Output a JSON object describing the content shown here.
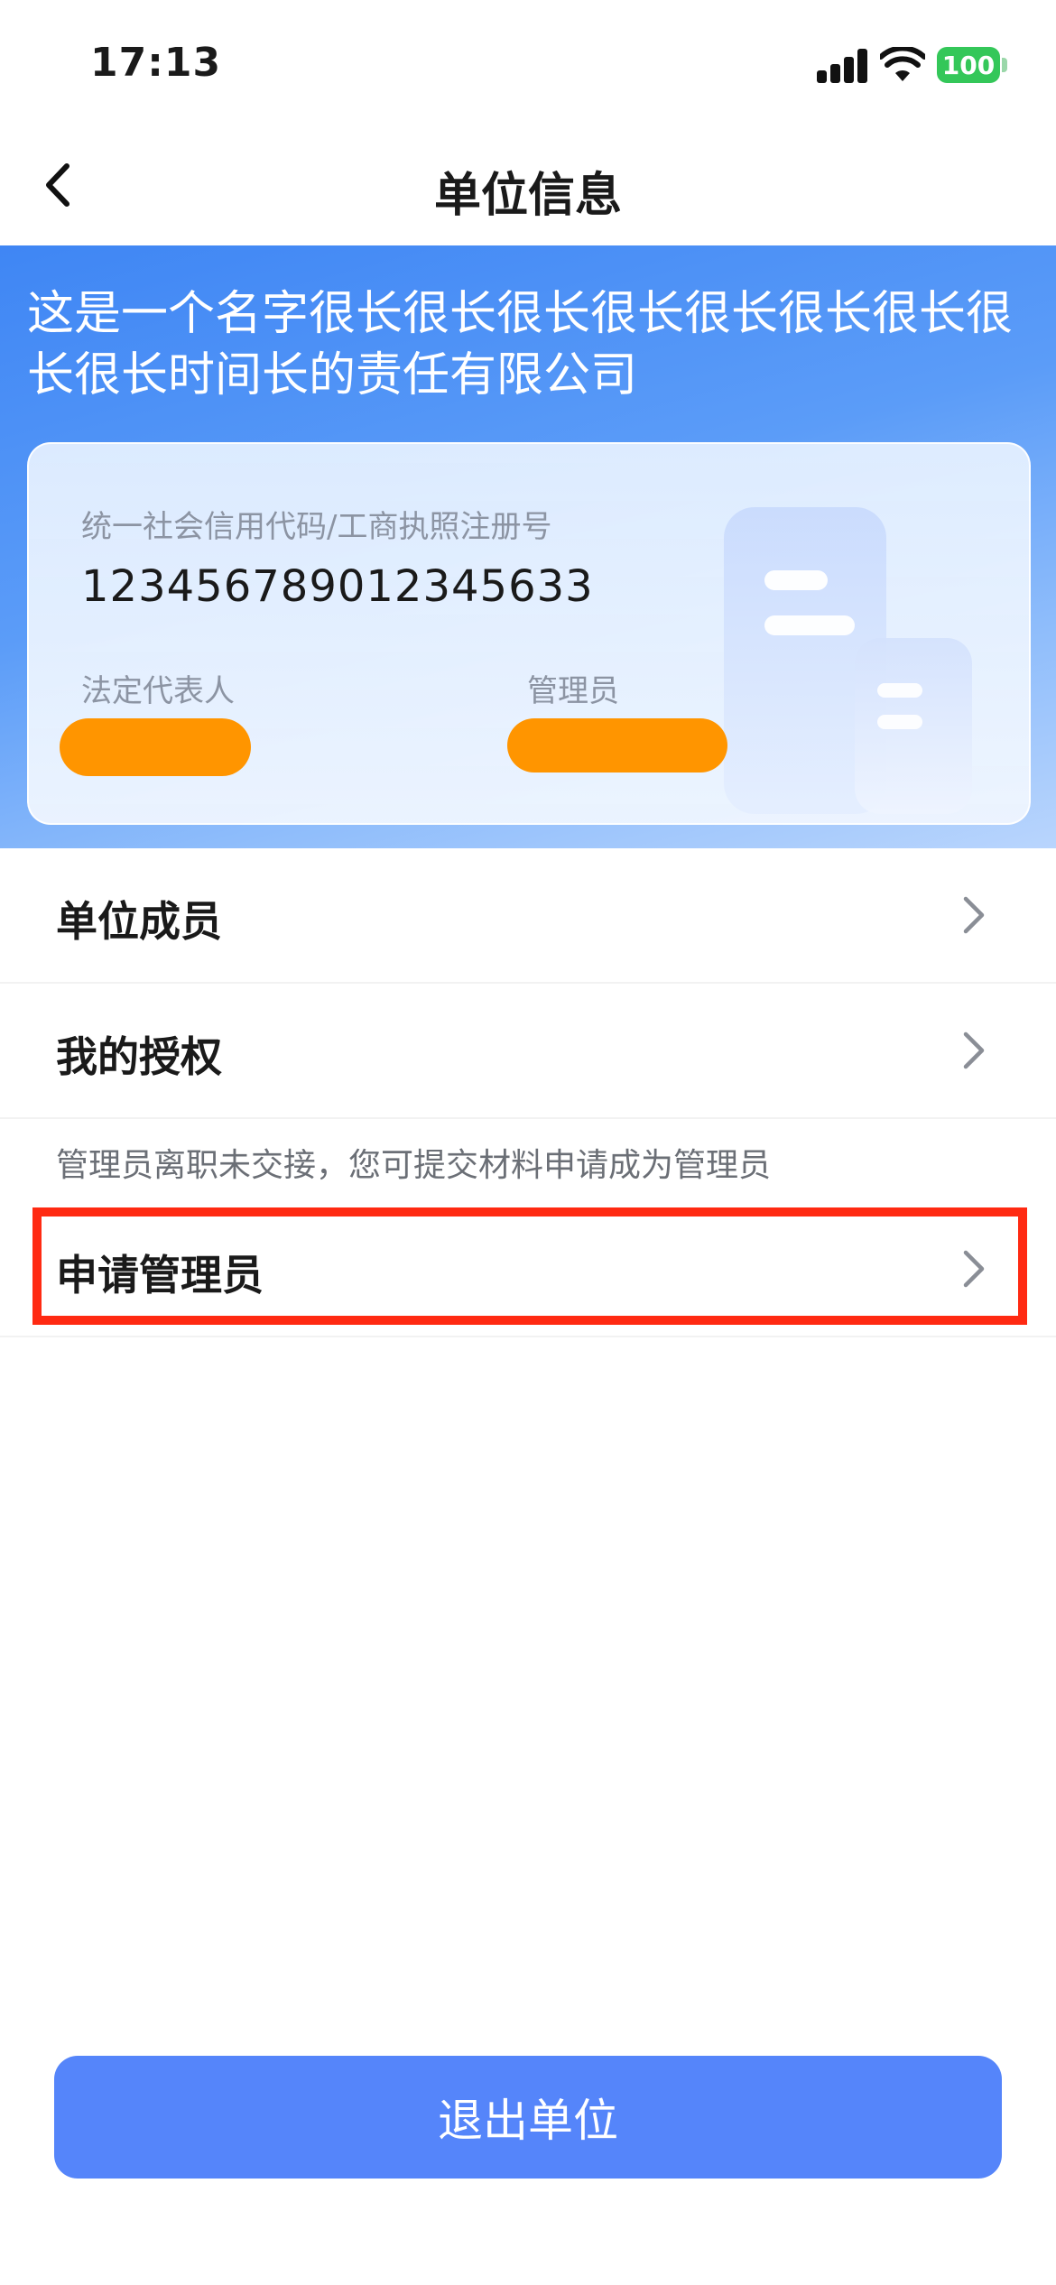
{
  "status_bar": {
    "time": "17:13",
    "battery": "100"
  },
  "nav": {
    "title": "单位信息"
  },
  "company": {
    "name": "这是一个名字很长很长很长很长很长很长很长很长很长时间长的责任有限公司",
    "credit_code_label": "统一社会信用代码/工商执照注册号",
    "credit_code": "123456789012345633",
    "legal_rep_label": "法定代表人",
    "admin_label": "管理员"
  },
  "menu": {
    "members": "单位成员",
    "my_auth": "我的授权",
    "hint": "管理员离职未交接，您可提交材料申请成为管理员",
    "apply_admin": "申请管理员"
  },
  "footer": {
    "exit_label": "退出单位"
  },
  "colors": {
    "accent": "#5585fa",
    "header_blue": "#3f86f4",
    "redaction": "#ff9500",
    "highlight": "#ff2a12"
  }
}
